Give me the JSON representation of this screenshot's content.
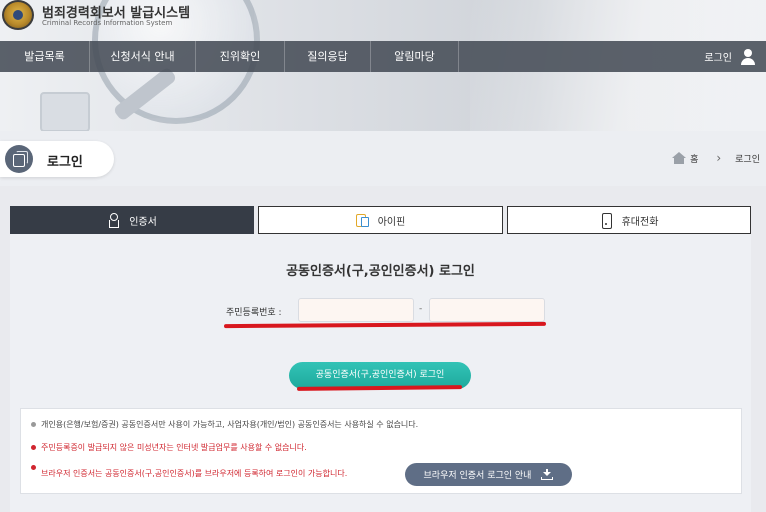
{
  "header": {
    "title": "범죄경력회보서 발급시스템",
    "subtitle": "Criminal Records Information System"
  },
  "nav": {
    "items": [
      {
        "label": "발급목록"
      },
      {
        "label": "신청서식 안내"
      },
      {
        "label": "진위확인"
      },
      {
        "label": "질의응답"
      },
      {
        "label": "알림마당"
      }
    ],
    "login_label": "로그인"
  },
  "page": {
    "title": "로그인"
  },
  "breadcrumb": {
    "home": "홈",
    "current": "로그인"
  },
  "tabs": [
    {
      "label": "인증서",
      "icon": "certificate-icon",
      "active": true
    },
    {
      "label": "아이핀",
      "icon": "ipin-icon",
      "active": false
    },
    {
      "label": "휴대전화",
      "icon": "mobile-phone-icon",
      "active": false
    }
  ],
  "login": {
    "heading": "공동인증서(구,공인인증서) 로그인",
    "rrn_label": "주민등록번호 :",
    "rrn_front_value": "",
    "rrn_back_value": "",
    "rrn_dash": "-",
    "submit_label": "공동인증서(구,공인인증서) 로그인"
  },
  "notices": [
    "개인용(은행/보험/증권) 공동인증서만 사용이 가능하고, 사업자용(개인/법인) 공동인증서는 사용하실 수 없습니다.",
    "주민등록증이 발급되지 않은 미성년자는 인터넷 발급업무를 사용할 수 없습니다.",
    "브라우저 인증서는 공동인증서(구,공인인증서)를 브라우저에 등록하여 로그인이 가능합니다."
  ],
  "browser_guide_label": "브라우저 인증서 로그인 안내",
  "colors": {
    "nav_bg": "#464c56",
    "active_tab": "#363c46",
    "primary_button": "#22b0a3",
    "guide_button": "#5f6e86",
    "warning_text": "#d0262f",
    "annotation_red": "#d8171e"
  }
}
